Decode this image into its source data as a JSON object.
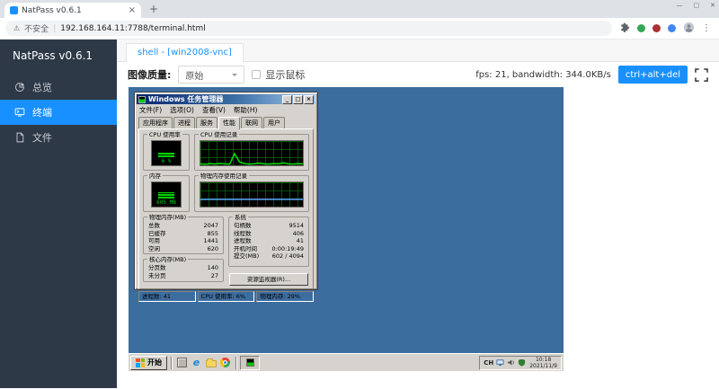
{
  "browser": {
    "tab_title": "NatPass v0.6.1",
    "security_label": "不安全",
    "url": "192.168.164.11:7788/terminal.html"
  },
  "sidebar": {
    "brand": "NatPass v0.6.1",
    "items": [
      {
        "label": "总览",
        "icon": "dashboard-icon"
      },
      {
        "label": "终端",
        "icon": "terminal-icon"
      },
      {
        "label": "文件",
        "icon": "file-icon"
      }
    ]
  },
  "session": {
    "tab": "shell - [win2008-vnc]",
    "quality_label": "图像质量:",
    "quality_value": "原始",
    "show_cursor": "显示鼠标",
    "stats": "fps: 21, bandwidth: 344.0KB/s",
    "cad": "ctrl+alt+del"
  },
  "taskmgr": {
    "title": "Windows 任务管理器",
    "menu": [
      "文件(F)",
      "选项(O)",
      "查看(V)",
      "帮助(H)"
    ],
    "tabs": [
      "应用程序",
      "进程",
      "服务",
      "性能",
      "联网",
      "用户"
    ],
    "active_tab": "性能",
    "cpu_gauge": {
      "label": "CPU 使用率",
      "text": "6 %",
      "pct": 28
    },
    "cpu_history_label": "CPU 使用记录",
    "cpu_history": [
      6,
      4,
      7,
      5,
      8,
      6,
      5,
      48,
      14,
      7,
      5,
      6,
      9,
      6,
      5,
      7,
      6,
      10,
      6,
      5,
      7,
      6
    ],
    "mem_gauge": {
      "label": "内存",
      "text": "605 MB",
      "pct": 40
    },
    "mem_history_label": "物理内存使用记录",
    "mem_history": [
      29,
      30,
      30,
      30,
      30,
      30,
      30,
      30,
      30,
      30,
      30,
      30,
      30,
      30,
      30,
      30,
      30,
      30,
      30,
      30,
      30,
      30
    ],
    "physical": {
      "title": "物理内存(MB)",
      "rows": [
        [
          "总数",
          "2047"
        ],
        [
          "已缓存",
          "855"
        ],
        [
          "可用",
          "1441"
        ],
        [
          "空闲",
          "620"
        ]
      ]
    },
    "kernel": {
      "title": "核心内存(MB)",
      "rows": [
        [
          "分页数",
          "140"
        ],
        [
          "未分页",
          "27"
        ]
      ]
    },
    "system": {
      "title": "系统",
      "rows": [
        [
          "句柄数",
          "9514"
        ],
        [
          "线程数",
          "406"
        ],
        [
          "进程数",
          "41"
        ],
        [
          "开机时间",
          "0:00:19:49"
        ],
        [
          "提交(MB)",
          "602 / 4094"
        ]
      ]
    },
    "resmon": "资源监视器(R)...",
    "status": [
      "进程数: 41",
      "CPU 使用率: 6%",
      "物理内存: 29%"
    ]
  },
  "win_taskbar": {
    "start": "开始",
    "language": "CH",
    "time": "10:18",
    "date": "2021/11/9"
  },
  "colors": {
    "accent": "#1890ff",
    "desktop": "#3c6d9f",
    "graph_green": "#00e000",
    "graph_blue": "#58a6ff"
  }
}
